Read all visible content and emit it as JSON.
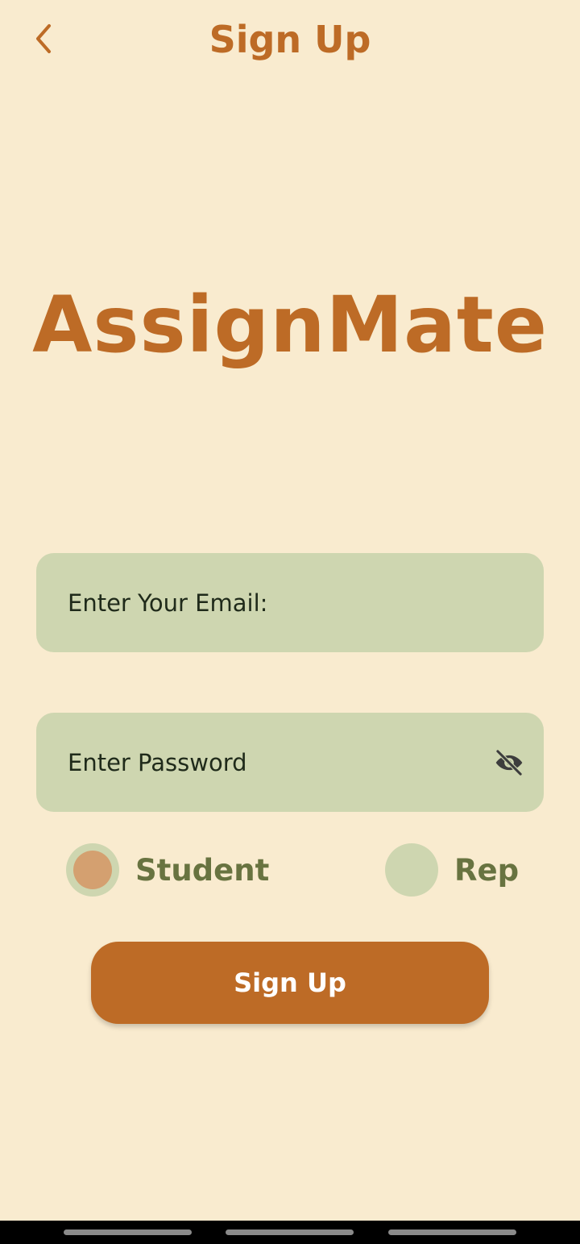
{
  "header": {
    "title": "Sign Up",
    "back_icon": "chevron-left-icon"
  },
  "logo": {
    "text": "AssignMate"
  },
  "form": {
    "email": {
      "placeholder": "Enter Your Email:",
      "value": ""
    },
    "password": {
      "placeholder": "Enter Password",
      "value": "",
      "toggle_icon": "eye-off-icon"
    },
    "roles": [
      {
        "label": "Student",
        "selected": true
      },
      {
        "label": "Rep",
        "selected": false
      }
    ],
    "submit_label": "Sign Up"
  },
  "colors": {
    "background": "#f9ebcf",
    "accent": "#bd6b26",
    "field_background": "#ced6b0",
    "radio_label": "#687340",
    "radio_selected_dot": "#d4a070"
  }
}
